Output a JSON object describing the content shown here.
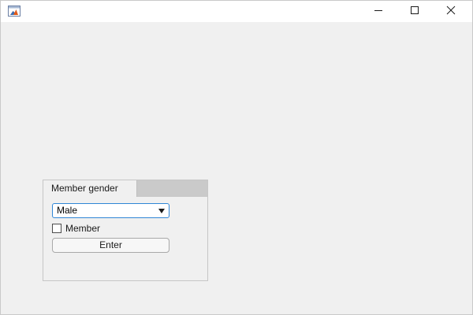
{
  "window": {
    "icon": "matlab-icon",
    "controls": {
      "minimize_icon": "minimize-icon",
      "maximize_icon": "maximize-icon",
      "close_icon": "close-icon"
    }
  },
  "tab_group": {
    "tabs": [
      {
        "label": "Member gender"
      }
    ],
    "dropdown": {
      "selected": "Male"
    },
    "checkbox": {
      "label": "Member",
      "checked": false
    },
    "enter_button": {
      "label": "Enter"
    }
  },
  "colors": {
    "background": "#f0f0f0",
    "focus_accent": "#2f86d6",
    "tab_strip": "#cacaca"
  }
}
